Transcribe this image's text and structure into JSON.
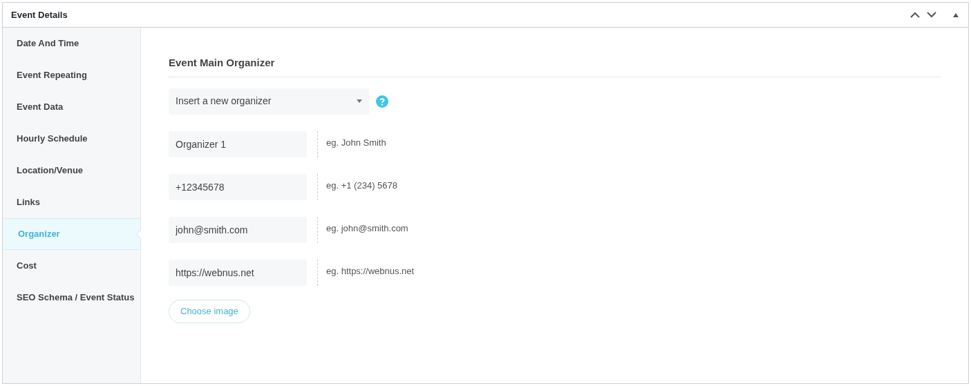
{
  "panel": {
    "title": "Event Details"
  },
  "sidebar": {
    "items": [
      {
        "label": "Date And Time",
        "selected": false
      },
      {
        "label": "Event Repeating",
        "selected": false
      },
      {
        "label": "Event Data",
        "selected": false
      },
      {
        "label": "Hourly Schedule",
        "selected": false
      },
      {
        "label": "Location/Venue",
        "selected": false
      },
      {
        "label": "Links",
        "selected": false
      },
      {
        "label": "Organizer",
        "selected": true
      },
      {
        "label": "Cost",
        "selected": false
      },
      {
        "label": "SEO Schema / Event Status",
        "selected": false
      }
    ]
  },
  "section": {
    "title": "Event Main Organizer",
    "select": {
      "value": "Insert a new organizer"
    },
    "fields": [
      {
        "value": "Organizer 1",
        "hint": "eg. John Smith"
      },
      {
        "value": "+12345678",
        "hint": "eg. +1 (234) 5678"
      },
      {
        "value": "john@smith.com",
        "hint": "eg. john@smith.com"
      },
      {
        "value": "https://webnus.net",
        "hint": "eg. https://webnus.net"
      }
    ],
    "button": "Choose image"
  }
}
